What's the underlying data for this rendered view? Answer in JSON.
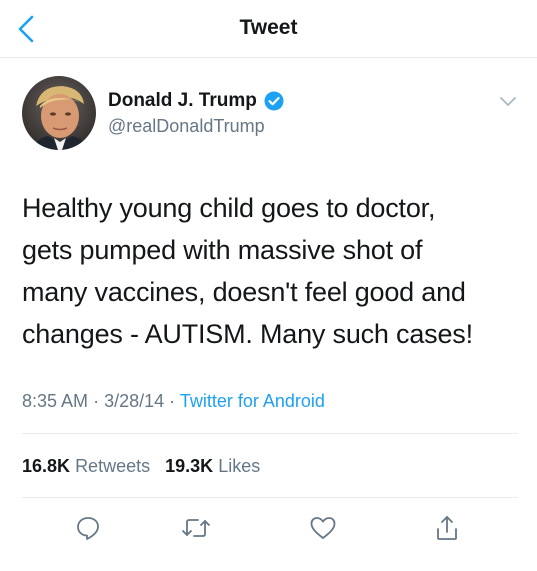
{
  "nav": {
    "title": "Tweet"
  },
  "author": {
    "name": "Donald J. Trump",
    "handle": "@realDonaldTrump",
    "verified": true
  },
  "tweet": {
    "lines": [
      "Healthy young child goes to doctor,",
      "gets pumped with massive shot of",
      "many vaccines, doesn't feel good and",
      "changes - AUTISM. Many such cases!"
    ],
    "time": "8:35 AM",
    "date": "3/28/14",
    "source": "Twitter for Android",
    "separator": "·"
  },
  "stats": {
    "retweets_count": "16.8K",
    "retweets_label": "Retweets",
    "likes_count": "19.3K",
    "likes_label": "Likes"
  },
  "colors": {
    "accent": "#1da1f2",
    "secondary_text": "#657786",
    "primary_text": "#14171a",
    "divider": "#e6ecf0"
  },
  "icons": [
    "back-chevron-icon",
    "verified-badge-icon",
    "chevron-down-icon",
    "reply-icon",
    "retweet-icon",
    "like-icon",
    "share-icon"
  ]
}
